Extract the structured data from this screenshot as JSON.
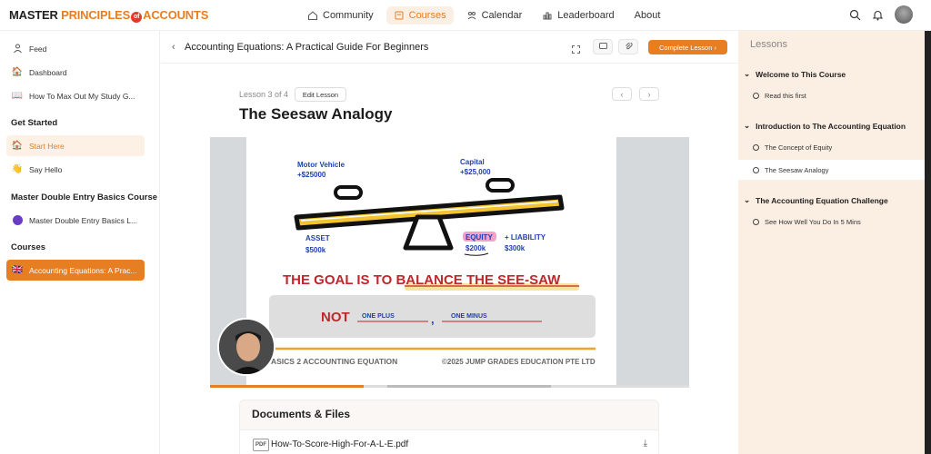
{
  "brand": {
    "part1": "MASTER ",
    "part2": "PRINCIPLES",
    "of": "of",
    "part3": "ACCOUNTS"
  },
  "nav": [
    {
      "label": "Community",
      "icon": "home-icon"
    },
    {
      "label": "Courses",
      "icon": "book-icon"
    },
    {
      "label": "Calendar",
      "icon": "calendar-icon"
    },
    {
      "label": "Leaderboard",
      "icon": "chart-icon"
    },
    {
      "label": "About",
      "icon": ""
    }
  ],
  "sidebar": {
    "items": [
      {
        "label": "Feed",
        "icon": "feed-icon"
      },
      {
        "label": "Dashboard",
        "icon": "house-icon"
      },
      {
        "label": "How To Max Out My Study G...",
        "icon": "book-open-icon"
      }
    ],
    "section_get_started": "Get Started",
    "get_started": [
      {
        "label": "Start Here",
        "icon": "house-icon"
      },
      {
        "label": "Say Hello",
        "icon": "wave-icon"
      }
    ],
    "section_double_entry": "Master Double Entry Basics Course",
    "double_entry": [
      {
        "label": "Master Double Entry Basics L...",
        "icon": "purple-dot-icon"
      }
    ],
    "section_courses": "Courses",
    "courses": [
      {
        "label": "Accounting Equations: A Prac...",
        "icon": "flag-icon"
      }
    ]
  },
  "lesson_bar": {
    "breadcrumb_title": "Accounting Equations: A Practical Guide For Beginners",
    "complete_label": "Complete Lesson ›"
  },
  "lesson": {
    "meta": "Lesson 3 of 4",
    "edit_label": "Edit Lesson",
    "title": "The Seesaw Analogy"
  },
  "slide": {
    "motor": "Motor Vehicle",
    "motor_val": "+$25000",
    "capital": "Capital",
    "capital_val": "+$25,000",
    "asset": "ASSET",
    "asset_val": "$500k",
    "equity": "EQUITY",
    "equity_val": "$200k",
    "liability": "+ LIABILITY",
    "liability_val": "$300k",
    "goal_prefix": "THE GOAL IS TO ",
    "goal_highlight": "BALANCE THE SEE-SAW",
    "not_text": "NOT",
    "one_plus": "ONE PLUS",
    "comma": ",",
    "one_minus": "ONE MINUS",
    "footer_left": "ASICS 2 ACCOUNTING EQUATION",
    "footer_right": "©2025 JUMP GRADES EDUCATION PTE LTD",
    "progress": 0.32
  },
  "documents": {
    "title": "Documents & Files",
    "files": [
      {
        "type": "PDF",
        "name": "How-To-Score-High-For-A-L-E.pdf"
      }
    ]
  },
  "lessons_panel": {
    "title": "Lessons",
    "sections": [
      {
        "title": "Welcome to This Course",
        "items": [
          {
            "label": "Read this first",
            "active": false
          }
        ]
      },
      {
        "title": "Introduction to The Accounting Equation",
        "items": [
          {
            "label": "The Concept of Equity",
            "active": false
          },
          {
            "label": "The Seesaw Analogy",
            "active": true
          }
        ]
      },
      {
        "title": "The Accounting Equation Challenge",
        "items": [
          {
            "label": "See How Well You Do In 5 Mins",
            "active": false
          }
        ]
      }
    ]
  },
  "colors": {
    "accent": "#e77e22",
    "highlight_bg": "#fbeee2",
    "slide_red": "#c0262b",
    "slide_blue": "#1e3fb4"
  }
}
